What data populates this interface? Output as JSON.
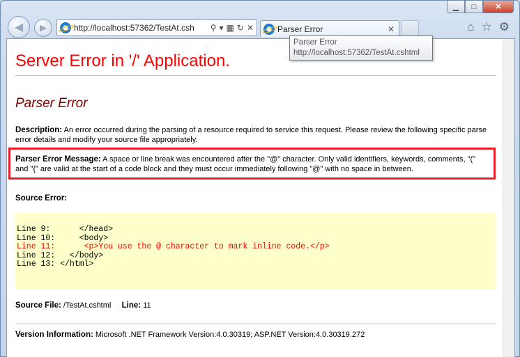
{
  "browser": {
    "url": "http://localhost:57362/TestAt.csh",
    "tab_title": "Parser Error",
    "tab_close": "✕",
    "tooltip_title": "Parser Error",
    "tooltip_url": "http://localhost:57362/TestAt.cshtml",
    "caption": {
      "minimize": "▁",
      "maximize": "□",
      "close": "✕"
    }
  },
  "page": {
    "title": "Server Error in '/' Application.",
    "subtitle": "Parser Error",
    "description_label": "Description:",
    "description_text": " An error occurred during the parsing of a resource required to service this request. Please review the following specific parse error details and modify your source file appropriately.",
    "message_label": "Parser Error Message:",
    "message_text": " A space or line break was encountered after the \"@\" character.  Only valid identifiers, keywords, comments, \"(\" and \"{\" are valid at the start of a code block and they must occur immediately following \"@\" with no space in between.",
    "source_error_label": "Source Error:",
    "code_lines": [
      {
        "text": "Line 9:      </head>",
        "error": false
      },
      {
        "text": "Line 10:     <body>",
        "error": false
      },
      {
        "text": "Line 11:      <p>You use the @ character to mark inline code.</p>",
        "error": true
      },
      {
        "text": "Line 12:   </body>",
        "error": false
      },
      {
        "text": "Line 13: </html>",
        "error": false
      }
    ],
    "source_file_label": "Source File:",
    "source_file": " /TestAt.cshtml",
    "line_label": "Line:",
    "line_value": " 11",
    "version_label": "Version Information:",
    "version_text": " Microsoft .NET Framework Version:4.0.30319; ASP.NET Version:4.0.30319.272"
  },
  "colors": {
    "title": "#ff0000",
    "subtitle": "#800000",
    "code_bg": "#ffffcc",
    "highlight_border": "#e8202a"
  }
}
